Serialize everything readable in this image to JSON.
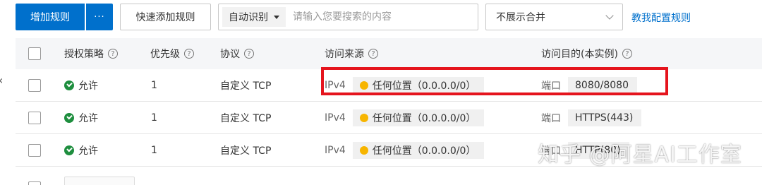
{
  "toolbar": {
    "add_rule": "增加规则",
    "more": "···",
    "quick_add": "快速添加规则",
    "search_type": "自动识别",
    "search_placeholder": "请输入您要搜索的内容",
    "merge_select": "不展示合并",
    "help_link": "教我配置规则"
  },
  "table": {
    "headers": {
      "policy": "授权策略",
      "priority": "优先级",
      "protocol": "协议",
      "source": "访问来源",
      "destination": "访问目的(本实例)"
    },
    "rows": [
      {
        "policy": "允许",
        "priority": "1",
        "protocol": "自定义 TCP",
        "ip_version": "IPv4",
        "source": "任何位置（0.0.0.0/0）",
        "port_label": "端口",
        "port": "8080/8080"
      },
      {
        "policy": "允许",
        "priority": "1",
        "protocol": "自定义 TCP",
        "ip_version": "IPv4",
        "source": "任何位置（0.0.0.0/0）",
        "port_label": "端口",
        "port": "HTTPS(443)"
      },
      {
        "policy": "允许",
        "priority": "1",
        "protocol": "自定义 TCP",
        "ip_version": "IPv4",
        "source": "任何位置（0.0.0.0/0）",
        "port_label": "端口",
        "port": "HTTP(80)"
      }
    ]
  },
  "watermark": "知乎 @阿星AI工作室",
  "colors": {
    "primary": "#0070cc",
    "allow": "#1e8e3e",
    "warn": "#f7b500",
    "highlight": "#e5141d"
  }
}
